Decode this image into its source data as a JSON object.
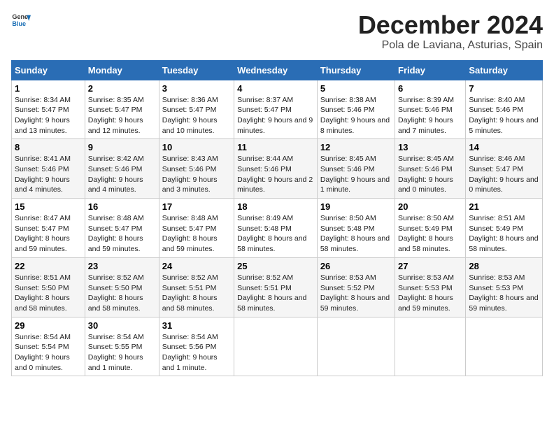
{
  "header": {
    "logo_general": "General",
    "logo_blue": "Blue",
    "month": "December 2024",
    "location": "Pola de Laviana, Asturias, Spain"
  },
  "days_of_week": [
    "Sunday",
    "Monday",
    "Tuesday",
    "Wednesday",
    "Thursday",
    "Friday",
    "Saturday"
  ],
  "weeks": [
    [
      {
        "day": "1",
        "sunrise": "8:34 AM",
        "sunset": "5:47 PM",
        "daylight": "9 hours and 13 minutes."
      },
      {
        "day": "2",
        "sunrise": "8:35 AM",
        "sunset": "5:47 PM",
        "daylight": "9 hours and 12 minutes."
      },
      {
        "day": "3",
        "sunrise": "8:36 AM",
        "sunset": "5:47 PM",
        "daylight": "9 hours and 10 minutes."
      },
      {
        "day": "4",
        "sunrise": "8:37 AM",
        "sunset": "5:47 PM",
        "daylight": "9 hours and 9 minutes."
      },
      {
        "day": "5",
        "sunrise": "8:38 AM",
        "sunset": "5:46 PM",
        "daylight": "9 hours and 8 minutes."
      },
      {
        "day": "6",
        "sunrise": "8:39 AM",
        "sunset": "5:46 PM",
        "daylight": "9 hours and 7 minutes."
      },
      {
        "day": "7",
        "sunrise": "8:40 AM",
        "sunset": "5:46 PM",
        "daylight": "9 hours and 5 minutes."
      }
    ],
    [
      {
        "day": "8",
        "sunrise": "8:41 AM",
        "sunset": "5:46 PM",
        "daylight": "9 hours and 4 minutes."
      },
      {
        "day": "9",
        "sunrise": "8:42 AM",
        "sunset": "5:46 PM",
        "daylight": "9 hours and 4 minutes."
      },
      {
        "day": "10",
        "sunrise": "8:43 AM",
        "sunset": "5:46 PM",
        "daylight": "9 hours and 3 minutes."
      },
      {
        "day": "11",
        "sunrise": "8:44 AM",
        "sunset": "5:46 PM",
        "daylight": "9 hours and 2 minutes."
      },
      {
        "day": "12",
        "sunrise": "8:45 AM",
        "sunset": "5:46 PM",
        "daylight": "9 hours and 1 minute."
      },
      {
        "day": "13",
        "sunrise": "8:45 AM",
        "sunset": "5:46 PM",
        "daylight": "9 hours and 0 minutes."
      },
      {
        "day": "14",
        "sunrise": "8:46 AM",
        "sunset": "5:47 PM",
        "daylight": "9 hours and 0 minutes."
      }
    ],
    [
      {
        "day": "15",
        "sunrise": "8:47 AM",
        "sunset": "5:47 PM",
        "daylight": "8 hours and 59 minutes."
      },
      {
        "day": "16",
        "sunrise": "8:48 AM",
        "sunset": "5:47 PM",
        "daylight": "8 hours and 59 minutes."
      },
      {
        "day": "17",
        "sunrise": "8:48 AM",
        "sunset": "5:47 PM",
        "daylight": "8 hours and 59 minutes."
      },
      {
        "day": "18",
        "sunrise": "8:49 AM",
        "sunset": "5:48 PM",
        "daylight": "8 hours and 58 minutes."
      },
      {
        "day": "19",
        "sunrise": "8:50 AM",
        "sunset": "5:48 PM",
        "daylight": "8 hours and 58 minutes."
      },
      {
        "day": "20",
        "sunrise": "8:50 AM",
        "sunset": "5:49 PM",
        "daylight": "8 hours and 58 minutes."
      },
      {
        "day": "21",
        "sunrise": "8:51 AM",
        "sunset": "5:49 PM",
        "daylight": "8 hours and 58 minutes."
      }
    ],
    [
      {
        "day": "22",
        "sunrise": "8:51 AM",
        "sunset": "5:50 PM",
        "daylight": "8 hours and 58 minutes."
      },
      {
        "day": "23",
        "sunrise": "8:52 AM",
        "sunset": "5:50 PM",
        "daylight": "8 hours and 58 minutes."
      },
      {
        "day": "24",
        "sunrise": "8:52 AM",
        "sunset": "5:51 PM",
        "daylight": "8 hours and 58 minutes."
      },
      {
        "day": "25",
        "sunrise": "8:52 AM",
        "sunset": "5:51 PM",
        "daylight": "8 hours and 58 minutes."
      },
      {
        "day": "26",
        "sunrise": "8:53 AM",
        "sunset": "5:52 PM",
        "daylight": "8 hours and 59 minutes."
      },
      {
        "day": "27",
        "sunrise": "8:53 AM",
        "sunset": "5:53 PM",
        "daylight": "8 hours and 59 minutes."
      },
      {
        "day": "28",
        "sunrise": "8:53 AM",
        "sunset": "5:53 PM",
        "daylight": "8 hours and 59 minutes."
      }
    ],
    [
      {
        "day": "29",
        "sunrise": "8:54 AM",
        "sunset": "5:54 PM",
        "daylight": "9 hours and 0 minutes."
      },
      {
        "day": "30",
        "sunrise": "8:54 AM",
        "sunset": "5:55 PM",
        "daylight": "9 hours and 1 minute."
      },
      {
        "day": "31",
        "sunrise": "8:54 AM",
        "sunset": "5:56 PM",
        "daylight": "9 hours and 1 minute."
      },
      null,
      null,
      null,
      null
    ]
  ]
}
